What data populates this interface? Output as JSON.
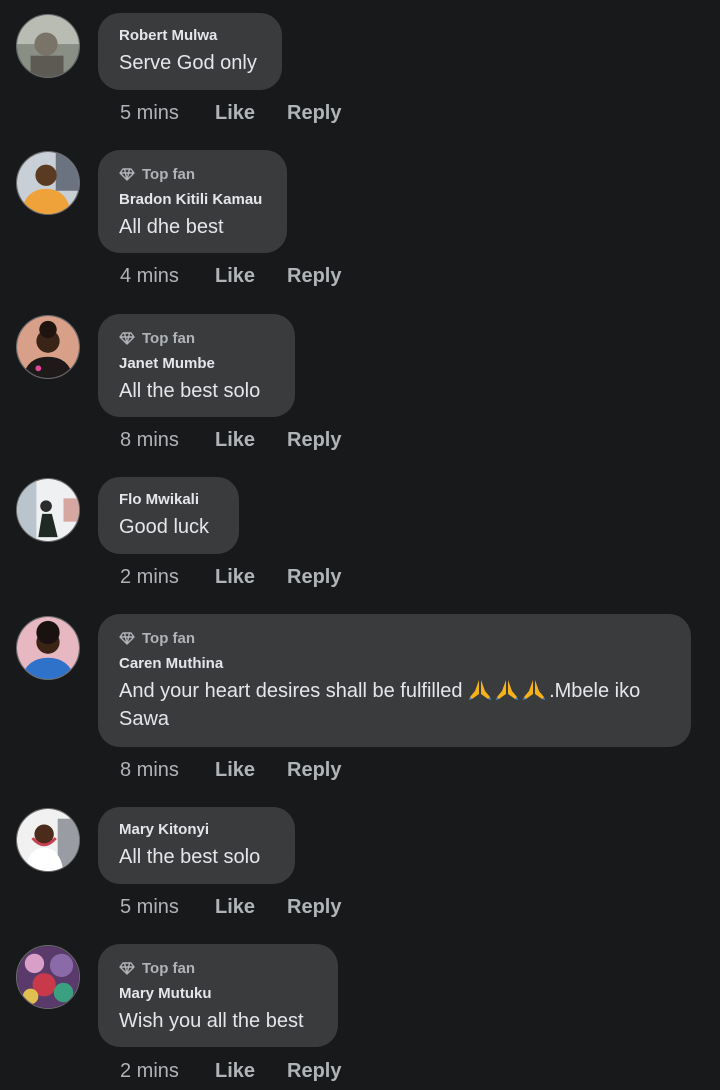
{
  "colors": {
    "background": "#18191a",
    "bubble": "#3a3b3c",
    "primary_text": "#e4e6eb",
    "secondary_text": "#b0b3b8"
  },
  "like_label": "Like",
  "reply_label": "Reply",
  "badge_icon": "diamond-icon",
  "comments": [
    {
      "author": "Robert Mulwa",
      "badge": "",
      "text": "Serve God only",
      "time": "5 mins"
    },
    {
      "author": "Bradon Kitili Kamau",
      "badge": "Top fan",
      "text": "All dhe best",
      "time": "4 mins"
    },
    {
      "author": "Janet Mumbe",
      "badge": "Top fan",
      "text": "All the best solo",
      "time": "8 mins"
    },
    {
      "author": "Flo Mwikali",
      "badge": "",
      "text": "Good luck",
      "time": "2 mins"
    },
    {
      "author": "Caren Muthina",
      "badge": "Top fan",
      "text_before": "And your heart desires shall be fulfilled ",
      "emoji": "folded-hands-emoji",
      "emoji_count": 3,
      "text_after": ".Mbele iko Sawa",
      "time": "8 mins"
    },
    {
      "author": "Mary Kitonyi",
      "badge": "",
      "text": "All the best solo",
      "time": "5 mins"
    },
    {
      "author": "Mary Mutuku",
      "badge": "Top fan",
      "text": "Wish you all the best",
      "time": "2 mins"
    }
  ]
}
